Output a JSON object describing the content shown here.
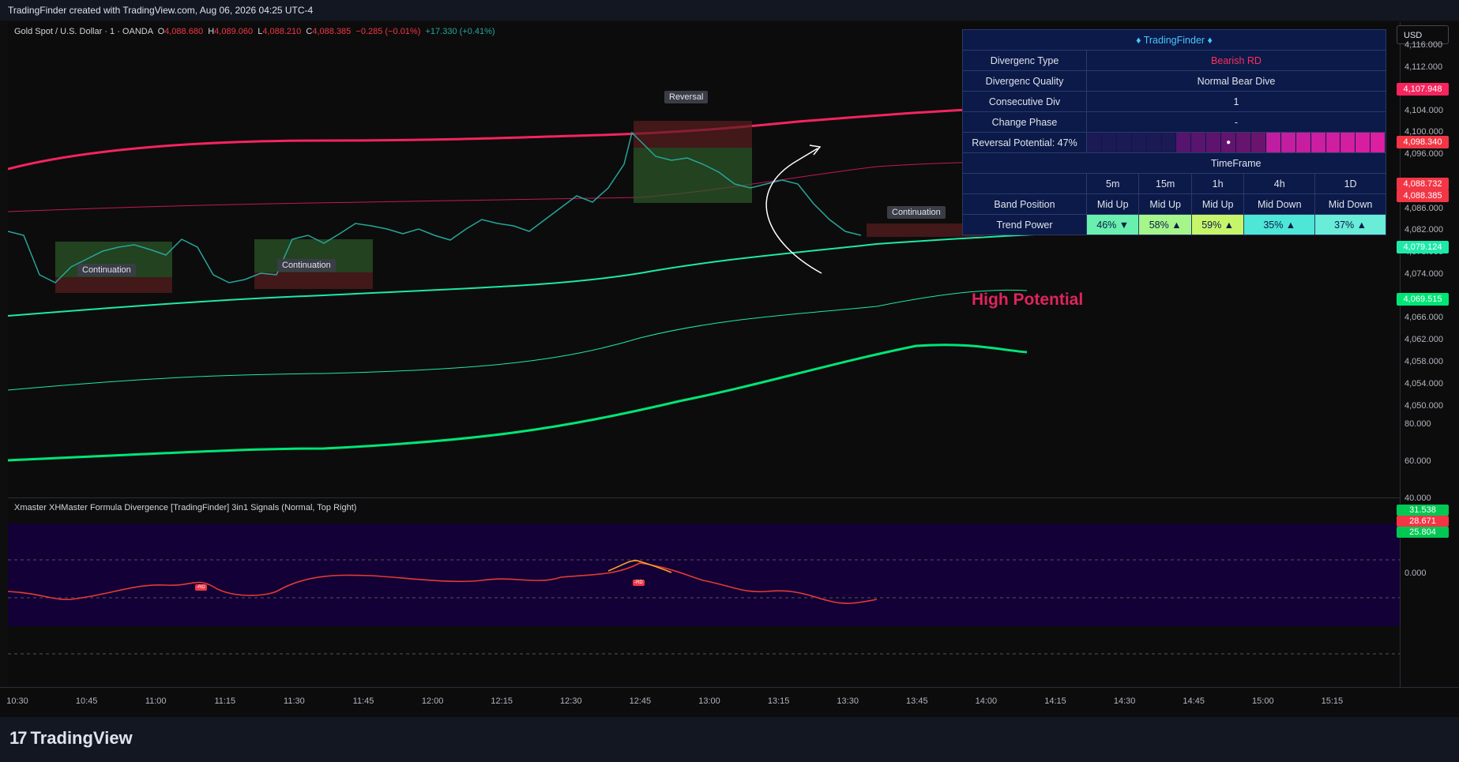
{
  "header": {
    "text": "TradingFinder created with TradingView.com, Aug 06, 2026 04:25 UTC-4"
  },
  "legend": {
    "symbol": "Gold Spot / U.S. Dollar · 1 · OANDA",
    "o_label": "O",
    "o_value": "4,088.680",
    "h_label": "H",
    "h_value": "4,089.060",
    "l_label": "L",
    "l_value": "4,088.210",
    "c_label": "C",
    "c_value": "4,088.385",
    "change": "−0.285 (−0.01%)",
    "change2": "+17.330 (+0.41%)"
  },
  "sub_legend": "Xmaster XHMaster Formula Divergence [TradingFinder] 3in1 Signals (Normal, Top Right)",
  "currency_button": "USD",
  "price_axis": [
    "4,116.000",
    "4,112.000",
    "4,104.000",
    "4,100.000",
    "4,096.000",
    "4,086.000",
    "4,082.000",
    "4,078.000",
    "4,074.000",
    "4,066.000",
    "4,062.000",
    "4,058.000",
    "4,054.000",
    "4,050.000"
  ],
  "price_tags": [
    {
      "value": "4,107.948",
      "color": "#f7245e"
    },
    {
      "value": "4,098.340",
      "color": "#f23645"
    },
    {
      "value": "4,088.732",
      "color": "#f23645"
    },
    {
      "value": "4,088.385",
      "color": "#f23645"
    },
    {
      "value": "4,079.124",
      "color": "#1de9a8"
    },
    {
      "value": "4,069.515",
      "color": "#00e676"
    }
  ],
  "osc_axis": [
    "80.000",
    "60.000",
    "40.000",
    "0.000"
  ],
  "osc_tags": [
    {
      "value": "31.538",
      "color": "#00c853"
    },
    {
      "value": "28.671",
      "color": "#f23645"
    },
    {
      "value": "25.804",
      "color": "#00c853"
    }
  ],
  "time_axis": [
    "10:30",
    "10:45",
    "11:00",
    "11:15",
    "11:30",
    "11:45",
    "12:00",
    "12:15",
    "12:30",
    "12:45",
    "13:00",
    "13:15",
    "13:30",
    "13:45",
    "14:00",
    "14:15",
    "14:30",
    "14:45",
    "15:00",
    "15:15"
  ],
  "markers": {
    "continuation": "Continuation",
    "reversal": "Reversal",
    "high_potential": "High Potential",
    "rd": "-RD"
  },
  "table": {
    "title": "♦ TradingFinder ♦",
    "rows": [
      {
        "key": "Divergenc Type",
        "value": "Bearish RD"
      },
      {
        "key": "Divergenc Quality",
        "value": "Normal Bear Dive"
      },
      {
        "key": "Consecutive Div",
        "value": "1"
      },
      {
        "key": "Change Phase",
        "value": "-"
      }
    ],
    "reversal_label": "Reversal Potential: 47%",
    "reversal_percent": 47,
    "timeframe_label": "TimeFrame",
    "timeframes": [
      "5m",
      "15m",
      "1h",
      "4h",
      "1D"
    ],
    "band_label": "Band Position",
    "band_values": [
      "Mid Up",
      "Mid Up",
      "Mid Up",
      "Mid Down",
      "Mid Down"
    ],
    "trend_label": "Trend Power",
    "trend_values": [
      {
        "text": "46% ▼",
        "color": "#69f0ae"
      },
      {
        "text": "58% ▲",
        "color": "#a5f58a"
      },
      {
        "text": "59% ▲",
        "color": "#c6f56a"
      },
      {
        "text": "35% ▲",
        "color": "#4ee6d6"
      },
      {
        "text": "37% ▲",
        "color": "#69ecd8"
      }
    ]
  },
  "footer_logo": "TradingView"
}
